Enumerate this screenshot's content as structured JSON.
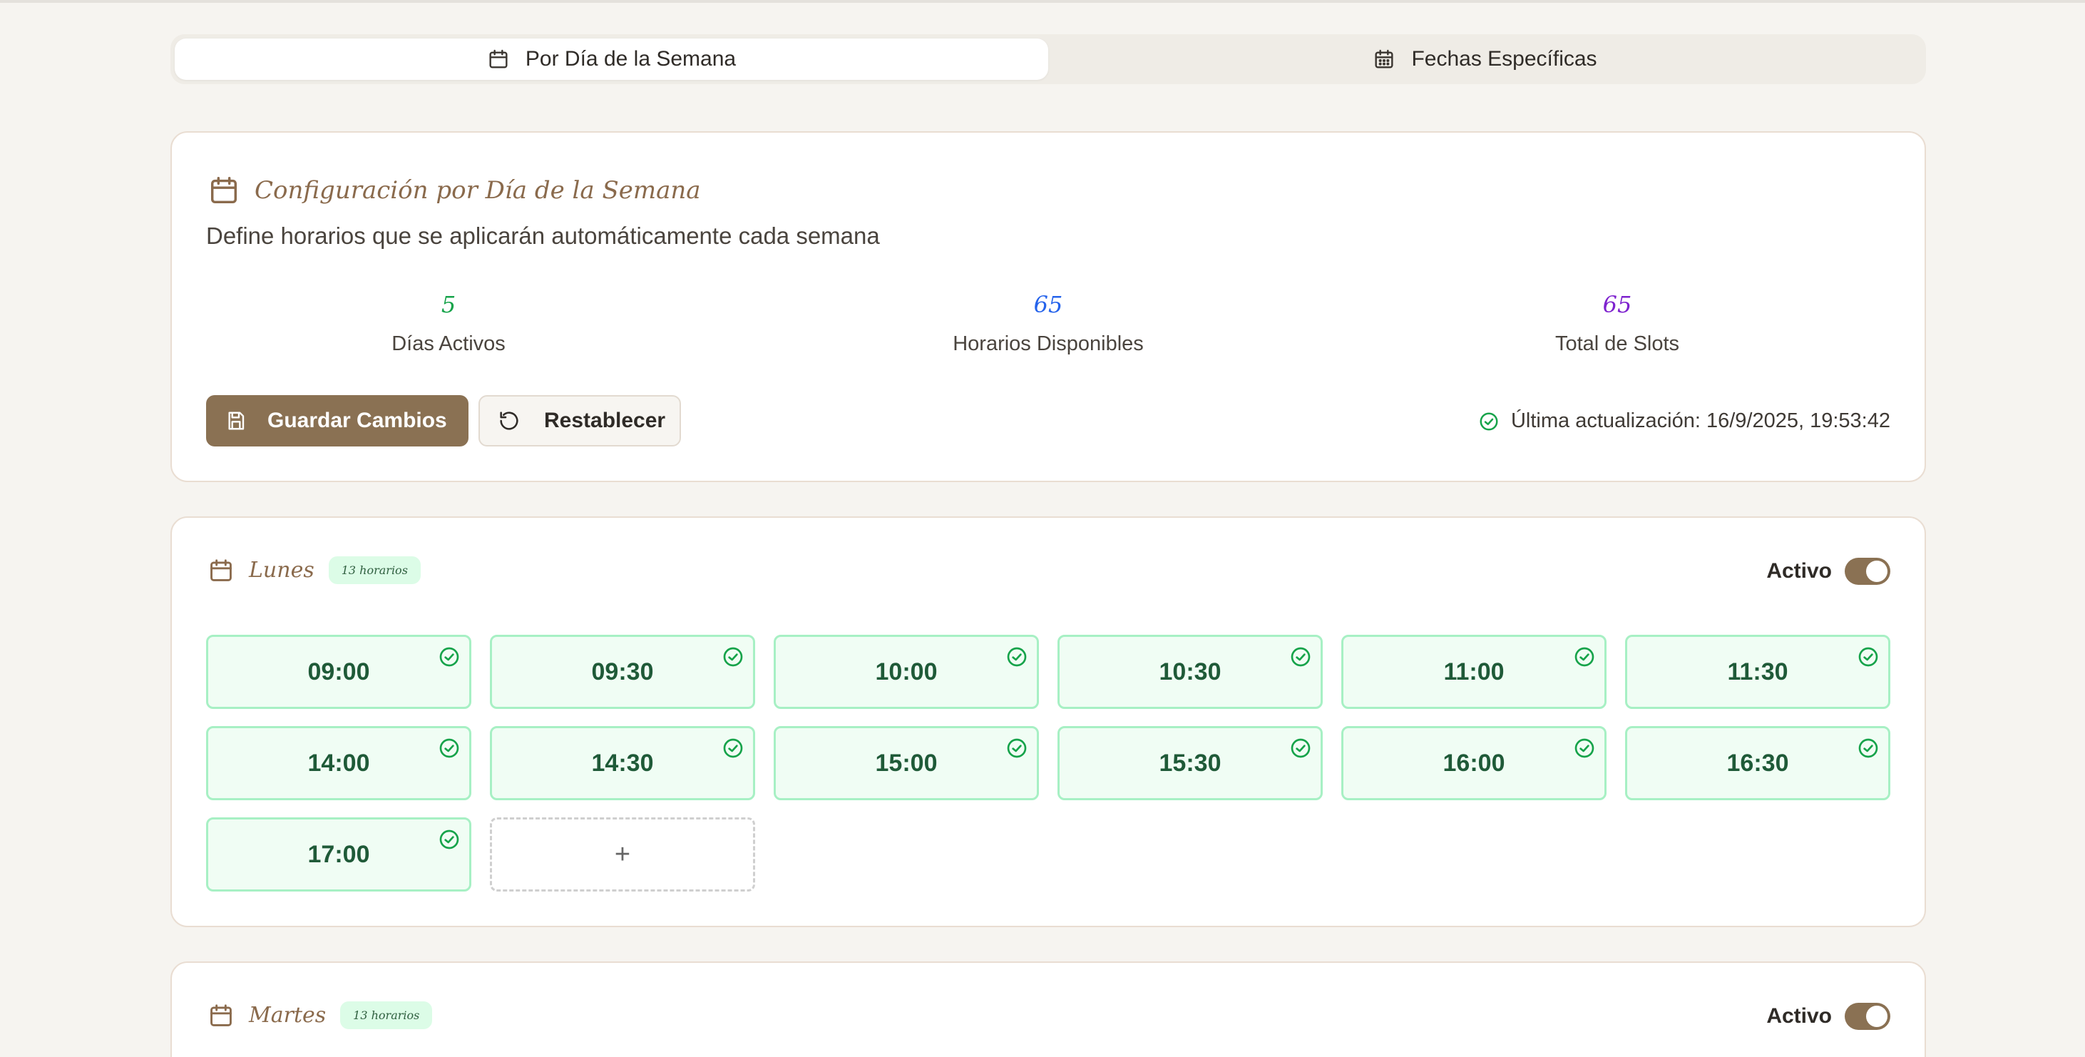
{
  "tabs": [
    {
      "label": "Por Día de la Semana",
      "icon": "calendar-icon",
      "active": true
    },
    {
      "label": "Fechas Específicas",
      "icon": "calendar-grid-icon",
      "active": false
    }
  ],
  "config": {
    "title": "Configuración por Día de la Semana",
    "subtitle": "Define horarios que se aplicarán automáticamente cada semana",
    "stats": [
      {
        "value": "5",
        "label": "Días Activos",
        "color": "#16a34a"
      },
      {
        "value": "65",
        "label": "Horarios Disponibles",
        "color": "#2563eb"
      },
      {
        "value": "65",
        "label": "Total de Slots",
        "color": "#7e22ce"
      }
    ],
    "save_label": "Guardar Cambios",
    "reset_label": "Restablecer",
    "last_update": "Última actualización: 16/9/2025, 19:53:42"
  },
  "days": [
    {
      "name": "Lunes",
      "badge": "13 horarios",
      "status_label": "Activo",
      "slots": [
        "09:00",
        "09:30",
        "10:00",
        "10:30",
        "11:00",
        "11:30",
        "14:00",
        "14:30",
        "15:00",
        "15:30",
        "16:00",
        "16:30",
        "17:00"
      ],
      "add_label": "+"
    },
    {
      "name": "Martes",
      "badge": "13 horarios",
      "status_label": "Activo"
    }
  ],
  "colors": {
    "accent": "#8a7153",
    "slot_bg": "#f0fdf4",
    "slot_border": "#a7f0c4",
    "slot_text": "#1f5a38",
    "check": "#16a34a"
  }
}
